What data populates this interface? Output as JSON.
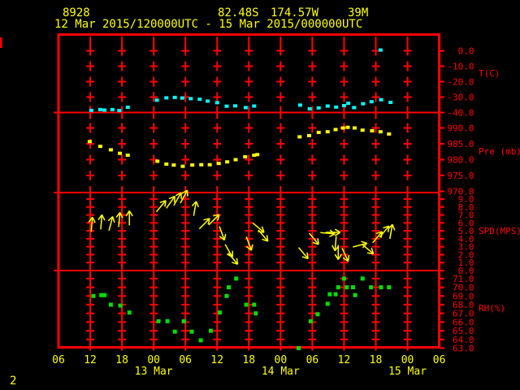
{
  "header": {
    "station_id": "8928",
    "latitude": "82.48S",
    "longitude": "174.57W",
    "elevation": "39M",
    "period": "12 Mar 2015/120000UTC - 15 Mar 2015/000000UTC"
  },
  "corner_label": "2",
  "colors": {
    "background": "#000000",
    "frame": "#ff0000",
    "header_text": "#ffff00",
    "temperature": "#00ffff",
    "pressure": "#ffff00",
    "wind": "#ffff00",
    "humidity": "#00dd00"
  },
  "x_axis": {
    "hour_labels": [
      "06",
      "12",
      "18",
      "00",
      "06",
      "12",
      "18",
      "00",
      "06",
      "12",
      "18",
      "00",
      "06"
    ],
    "date_labels": [
      {
        "text": "13 Mar",
        "tick_index": 3
      },
      {
        "text": "14 Mar",
        "tick_index": 7
      },
      {
        "text": "15 Mar",
        "tick_index": 11
      }
    ],
    "hours_total": 72
  },
  "chart_data": [
    {
      "type": "scatter",
      "name": "temperature",
      "ylabel": "T(C)",
      "color": "#00ffff",
      "tick_values": [
        0,
        -10,
        -20,
        -30,
        -40
      ],
      "tick_labels": [
        "0.0",
        "-10.0",
        "-20.0",
        "-30.0",
        "-40.0"
      ],
      "x_unit": "hours after 12 Mar 2015 06UTC",
      "points": [
        [
          6.2,
          -38.6
        ],
        [
          7.9,
          -38.1
        ],
        [
          8.7,
          -38.4
        ],
        [
          10.2,
          -38.1
        ],
        [
          11.5,
          -38.7
        ],
        [
          13.1,
          -36.6
        ],
        [
          18.6,
          -32.0
        ],
        [
          20.4,
          -30.5
        ],
        [
          22.0,
          -30.2
        ],
        [
          23.4,
          -30.6
        ],
        [
          25.0,
          -31.0
        ],
        [
          26.7,
          -31.4
        ],
        [
          28.2,
          -32.6
        ],
        [
          30.0,
          -33.6
        ],
        [
          31.8,
          -35.9
        ],
        [
          33.4,
          -35.7
        ],
        [
          35.4,
          -36.8
        ],
        [
          37.0,
          -35.8
        ],
        [
          45.7,
          -35.2
        ],
        [
          47.5,
          -37.6
        ],
        [
          49.2,
          -37.0
        ],
        [
          50.9,
          -35.8
        ],
        [
          52.5,
          -36.5
        ],
        [
          54.0,
          -35.5
        ],
        [
          54.8,
          -34.0
        ],
        [
          55.9,
          -36.8
        ],
        [
          57.6,
          -34.3
        ],
        [
          59.2,
          -33.0
        ],
        [
          60.9,
          0.5
        ],
        [
          61.0,
          -31.7
        ],
        [
          62.8,
          -33.4
        ]
      ]
    },
    {
      "type": "scatter",
      "name": "pressure",
      "ylabel": "Pre (mb)",
      "color": "#ffff00",
      "tick_values": [
        990,
        985,
        980,
        975,
        970
      ],
      "tick_labels": [
        "990.0",
        "985.0",
        "980.0",
        "975.0",
        "970.0"
      ],
      "x_unit": "hours after 12 Mar 2015 06UTC",
      "points": [
        [
          5.9,
          985.7
        ],
        [
          7.9,
          984.2
        ],
        [
          9.9,
          983.1
        ],
        [
          11.6,
          982.0
        ],
        [
          13.1,
          981.4
        ],
        [
          18.7,
          979.5
        ],
        [
          20.4,
          978.6
        ],
        [
          21.8,
          978.3
        ],
        [
          23.5,
          977.9
        ],
        [
          25.3,
          978.3
        ],
        [
          27.0,
          978.4
        ],
        [
          28.6,
          978.4
        ],
        [
          30.3,
          978.8
        ],
        [
          31.9,
          979.3
        ],
        [
          33.5,
          980.0
        ],
        [
          35.3,
          980.9
        ],
        [
          37.0,
          981.4
        ],
        [
          37.6,
          981.6
        ],
        [
          45.6,
          987.2
        ],
        [
          47.4,
          987.6
        ],
        [
          49.2,
          988.6
        ],
        [
          50.9,
          988.8
        ],
        [
          52.4,
          989.5
        ],
        [
          53.8,
          990.0
        ],
        [
          54.7,
          990.2
        ],
        [
          56.0,
          990.0
        ],
        [
          57.5,
          989.3
        ],
        [
          59.3,
          989.1
        ],
        [
          60.9,
          988.8
        ],
        [
          62.5,
          988.1
        ]
      ]
    },
    {
      "type": "wind-vector",
      "name": "wind-speed",
      "ylabel": "SPD(MPS)",
      "color": "#ffff00",
      "tick_values": [
        9,
        8,
        7,
        6,
        5,
        4,
        3,
        2,
        1,
        0
      ],
      "tick_labels": [
        "9.0",
        "8.0",
        "7.0",
        "6.0",
        "5.0",
        "4.0",
        "3.0",
        "2.0",
        "1.0",
        "0.0"
      ],
      "x_unit": "hours after 12 Mar 2015 06UTC",
      "points": [
        [
          6.3,
          5.8,
          5
        ],
        [
          8.1,
          6.1,
          5
        ],
        [
          9.9,
          5.9,
          15
        ],
        [
          11.5,
          6.4,
          5
        ],
        [
          13.4,
          6.6,
          0
        ],
        [
          19.4,
          8.1,
          40
        ],
        [
          21.2,
          8.6,
          35
        ],
        [
          22.5,
          9.0,
          30
        ],
        [
          23.7,
          9.3,
          28
        ],
        [
          25.8,
          7.8,
          10
        ],
        [
          27.6,
          5.9,
          45
        ],
        [
          29.4,
          6.4,
          45
        ],
        [
          30.9,
          4.7,
          160
        ],
        [
          32.2,
          2.5,
          150
        ],
        [
          33.0,
          1.5,
          140
        ],
        [
          36.0,
          3.4,
          160
        ],
        [
          37.8,
          5.4,
          130
        ],
        [
          38.7,
          4.4,
          140
        ],
        [
          46.3,
          2.2,
          140
        ],
        [
          48.3,
          4.0,
          140
        ],
        [
          50.9,
          4.7,
          95
        ],
        [
          51.9,
          4.8,
          90
        ],
        [
          52.4,
          3.4,
          185
        ],
        [
          52.9,
          2.3,
          180
        ],
        [
          54.2,
          2.0,
          155
        ],
        [
          57.0,
          3.2,
          75
        ],
        [
          58.5,
          2.7,
          130
        ],
        [
          60.3,
          4.2,
          40
        ],
        [
          61.6,
          4.9,
          40
        ],
        [
          62.9,
          4.9,
          10
        ]
      ]
    },
    {
      "type": "scatter",
      "name": "humidity",
      "ylabel": "RH(%)",
      "color": "#00dd00",
      "tick_values": [
        71,
        70,
        69,
        68,
        67,
        66,
        65,
        64,
        63
      ],
      "tick_labels": [
        "71.0",
        "70.0",
        "69.0",
        "68.0",
        "67.0",
        "66.0",
        "65.0",
        "64.0",
        "63.0"
      ],
      "x_unit": "hours after 12 Mar 2015 06UTC",
      "points": [
        [
          6.6,
          69.0
        ],
        [
          8.1,
          69.1
        ],
        [
          8.7,
          69.1
        ],
        [
          9.9,
          68.0
        ],
        [
          11.7,
          67.9
        ],
        [
          13.4,
          67.1
        ],
        [
          18.9,
          66.1
        ],
        [
          20.6,
          66.1
        ],
        [
          22.0,
          64.9
        ],
        [
          23.7,
          66.1
        ],
        [
          25.2,
          64.9
        ],
        [
          26.9,
          63.9
        ],
        [
          28.8,
          65.0
        ],
        [
          30.5,
          67.1
        ],
        [
          31.8,
          69.0
        ],
        [
          32.2,
          70.0
        ],
        [
          33.6,
          71.0
        ],
        [
          35.5,
          68.0
        ],
        [
          37.0,
          68.0
        ],
        [
          37.3,
          67.0
        ],
        [
          45.4,
          63.0
        ],
        [
          47.7,
          66.1
        ],
        [
          49.0,
          66.9
        ],
        [
          50.9,
          68.1
        ],
        [
          51.3,
          69.2
        ],
        [
          52.4,
          69.2
        ],
        [
          52.9,
          70.0
        ],
        [
          54.0,
          71.0
        ],
        [
          54.5,
          70.0
        ],
        [
          55.7,
          70.0
        ],
        [
          56.1,
          69.1
        ],
        [
          57.5,
          71.0
        ],
        [
          59.1,
          70.0
        ],
        [
          61.0,
          70.0
        ],
        [
          62.5,
          70.0
        ]
      ]
    }
  ]
}
